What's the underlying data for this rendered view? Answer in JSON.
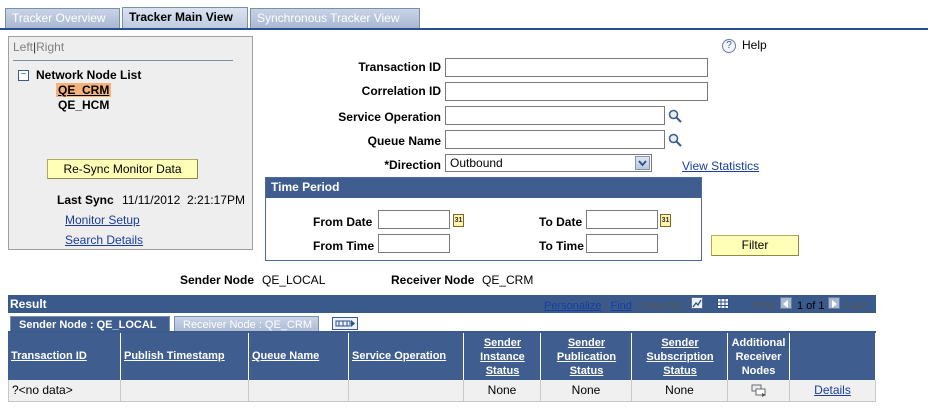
{
  "tabs": [
    {
      "label": "Tracker Overview",
      "active": false
    },
    {
      "label": "Tracker Main View",
      "active": true
    },
    {
      "label": "Synchronous Tracker View",
      "active": false
    }
  ],
  "left_panel": {
    "left_label": "Left",
    "separator": "|",
    "right_label": "Right",
    "tree_toggle": "−",
    "tree_title": "Network Node List",
    "nodes": [
      "QE_CRM",
      "QE_HCM"
    ],
    "resync_button": "Re-Sync Monitor Data",
    "last_sync_label": "Last Sync",
    "last_sync_value": "11/11/2012  2:21:17PM",
    "monitor_setup_link": "Monitor Setup",
    "search_details_link": "Search Details"
  },
  "help": {
    "icon": "?",
    "label": "Help"
  },
  "form": {
    "transaction_id_label": "Transaction ID",
    "transaction_id_value": "",
    "correlation_id_label": "Correlation ID",
    "correlation_id_value": "",
    "service_operation_label": "Service Operation",
    "service_operation_value": "",
    "queue_name_label": "Queue Name",
    "queue_name_value": "",
    "direction_label": "*Direction",
    "direction_value": "Outbound",
    "view_statistics_link": "View Statistics"
  },
  "time_period": {
    "title": "Time Period",
    "from_date_label": "From Date",
    "to_date_label": "To Date",
    "from_time_label": "From Time",
    "to_time_label": "To Time",
    "calendar_icon_text": "31"
  },
  "filter_button": "Filter",
  "nodes_info": {
    "sender_node_label": "Sender Node",
    "sender_node_value": "QE_LOCAL",
    "receiver_node_label": "Receiver Node",
    "receiver_node_value": "QE_CRM"
  },
  "result": {
    "title": "Result",
    "personalize": "Personalize",
    "separator": "|",
    "find": "Find",
    "view_all": "View All",
    "first": "First",
    "pagination": "1 of 1",
    "last": "Last",
    "subtabs": [
      "Sender Node : QE_LOCAL",
      "Receiver Node : QE_CRM"
    ],
    "columns": [
      "Transaction ID",
      "Publish Timestamp",
      "Queue Name",
      "Service Operation",
      "Sender Instance Status",
      "Sender Publication Status",
      "Sender Subscription Status",
      "Additional Receiver Nodes",
      ""
    ],
    "rows": [
      [
        "?<no data>",
        "",
        "",
        "",
        "None",
        "None",
        "None",
        "",
        "Details"
      ]
    ]
  },
  "colors": {
    "header_blue": "#3f5e8f",
    "link_blue": "#1a3c9e",
    "button_yellow": "#ffffb8",
    "selected_node": "#f5b27a"
  }
}
